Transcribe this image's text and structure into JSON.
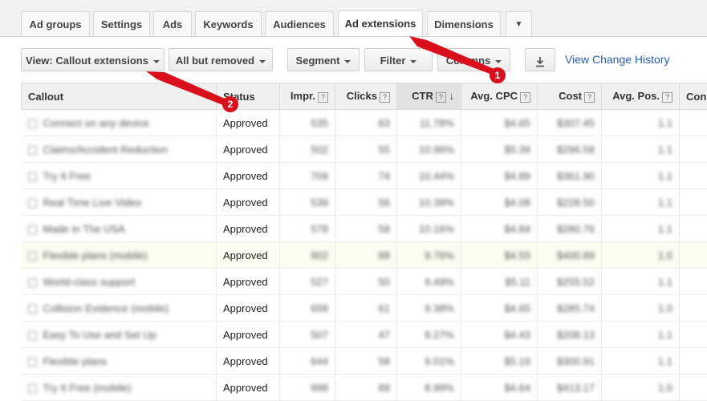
{
  "tabs": [
    {
      "label": "Ad groups"
    },
    {
      "label": "Settings"
    },
    {
      "label": "Ads"
    },
    {
      "label": "Keywords"
    },
    {
      "label": "Audiences"
    },
    {
      "label": "Ad extensions",
      "active": true
    },
    {
      "label": "Dimensions"
    }
  ],
  "tabs_more_icon": "▼",
  "toolbar": {
    "view_label": "View: Callout extensions",
    "filter_removed_label": "All but removed",
    "segment_label": "Segment",
    "filter_label": "Filter",
    "columns_label": "Columns",
    "download_icon": "download-icon",
    "history_link": "View Change History"
  },
  "table": {
    "headers": {
      "callout": "Callout",
      "status": "Status",
      "impr": "Impr.",
      "clicks": "Clicks",
      "ctr": "CTR",
      "avg_cpc": "Avg. CPC",
      "cost": "Cost",
      "avg_pos": "Avg. Pos.",
      "conv": "Con"
    },
    "help_mark": "?",
    "sort_arrow": "↓",
    "rows": [
      {
        "callout": "Connect on any device",
        "status": "Approved",
        "impr": "535",
        "clicks": "63",
        "ctr": "11.78%",
        "cpc": "$4.65",
        "cost": "$307.45",
        "pos": "1.1"
      },
      {
        "callout": "Claims/Accident Reduction",
        "status": "Approved",
        "impr": "502",
        "clicks": "55",
        "ctr": "10.96%",
        "cpc": "$5.39",
        "cost": "$296.58",
        "pos": "1.1"
      },
      {
        "callout": "Try It Free",
        "status": "Approved",
        "impr": "709",
        "clicks": "74",
        "ctr": "10.44%",
        "cpc": "$4.89",
        "cost": "$361.90",
        "pos": "1.1"
      },
      {
        "callout": "Real Time Live Video",
        "status": "Approved",
        "impr": "539",
        "clicks": "56",
        "ctr": "10.39%",
        "cpc": "$4.08",
        "cost": "$228.50",
        "pos": "1.1"
      },
      {
        "callout": "Made in The USA",
        "status": "Approved",
        "impr": "578",
        "clicks": "58",
        "ctr": "10.16%",
        "cpc": "$4.84",
        "cost": "$280.76",
        "pos": "1.1"
      },
      {
        "callout": "Flexible plans (mobile)",
        "status": "Approved",
        "impr": "902",
        "clicks": "88",
        "ctr": "9.76%",
        "cpc": "$4.55",
        "cost": "$400.89",
        "pos": "1.0",
        "highlight": true
      },
      {
        "callout": "World-class support",
        "status": "Approved",
        "impr": "527",
        "clicks": "50",
        "ctr": "9.49%",
        "cpc": "$5.11",
        "cost": "$255.52",
        "pos": "1.1"
      },
      {
        "callout": "Collision Evidence (mobile)",
        "status": "Approved",
        "impr": "658",
        "clicks": "61",
        "ctr": "9.38%",
        "cpc": "$4.65",
        "cost": "$285.74",
        "pos": "1.0"
      },
      {
        "callout": "Easy To Use and Set Up",
        "status": "Approved",
        "impr": "507",
        "clicks": "47",
        "ctr": "9.27%",
        "cpc": "$4.43",
        "cost": "$208.13",
        "pos": "1.1"
      },
      {
        "callout": "Flexible plans",
        "status": "Approved",
        "impr": "644",
        "clicks": "58",
        "ctr": "9.01%",
        "cpc": "$5.19",
        "cost": "$300.91",
        "pos": "1.1"
      },
      {
        "callout": "Try It Free (mobile)",
        "status": "Approved",
        "impr": "998",
        "clicks": "89",
        "ctr": "8.99%",
        "cpc": "$4.64",
        "cost": "$413.17",
        "pos": "1.0"
      }
    ]
  },
  "annotations": {
    "badge1": "1",
    "badge2": "2",
    "color": "#d9101c"
  }
}
